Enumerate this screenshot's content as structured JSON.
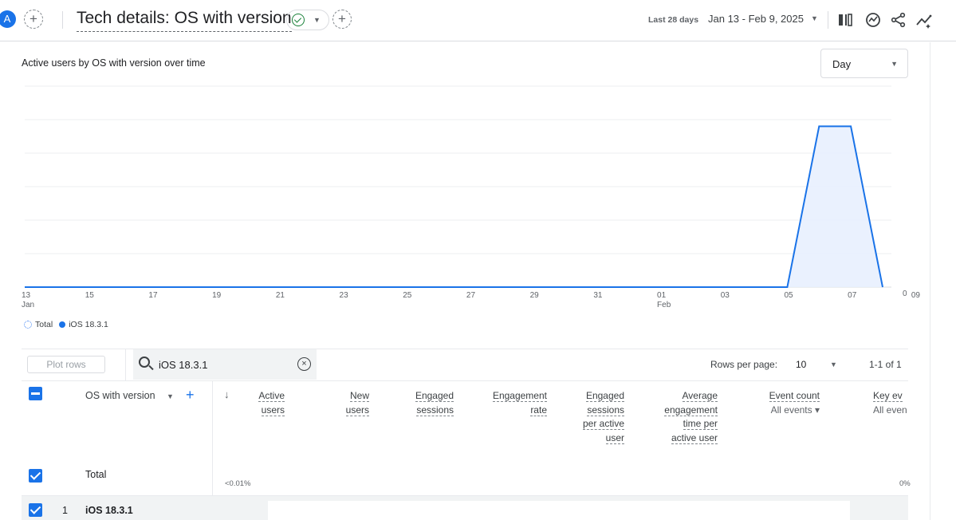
{
  "header": {
    "avatar_letter": "A",
    "report_title": "Tech details: OS with version",
    "date_label": "Last 28 days",
    "date_range": "Jan 13 - Feb 9, 2025",
    "icons": [
      "compare-icon",
      "insights-icon",
      "share-icon",
      "trending-icon"
    ]
  },
  "chart": {
    "title": "Active users by OS with version over time",
    "granularity": "Day",
    "y_tick_zero": "0",
    "legend": {
      "total": "Total",
      "series": "iOS 18.3.1"
    },
    "x_ticks": [
      {
        "day": "13",
        "month": "Jan"
      },
      {
        "day": "15",
        "month": ""
      },
      {
        "day": "17",
        "month": ""
      },
      {
        "day": "19",
        "month": ""
      },
      {
        "day": "21",
        "month": ""
      },
      {
        "day": "23",
        "month": ""
      },
      {
        "day": "25",
        "month": ""
      },
      {
        "day": "27",
        "month": ""
      },
      {
        "day": "29",
        "month": ""
      },
      {
        "day": "31",
        "month": ""
      },
      {
        "day": "01",
        "month": "Feb"
      },
      {
        "day": "03",
        "month": ""
      },
      {
        "day": "05",
        "month": ""
      },
      {
        "day": "07",
        "month": ""
      },
      {
        "day": "09",
        "month": ""
      }
    ]
  },
  "chart_data": {
    "type": "area",
    "title": "Active users by OS with version over time",
    "x": [
      "Jan 13",
      "Jan 14",
      "Jan 15",
      "Jan 16",
      "Jan 17",
      "Jan 18",
      "Jan 19",
      "Jan 20",
      "Jan 21",
      "Jan 22",
      "Jan 23",
      "Jan 24",
      "Jan 25",
      "Jan 26",
      "Jan 27",
      "Jan 28",
      "Jan 29",
      "Jan 30",
      "Jan 31",
      "Feb 01",
      "Feb 02",
      "Feb 03",
      "Feb 04",
      "Feb 05",
      "Feb 06",
      "Feb 07",
      "Feb 08",
      "Feb 09"
    ],
    "series": [
      {
        "name": "iOS 18.3.1",
        "values": [
          0,
          0,
          0,
          0,
          0,
          0,
          0,
          0,
          0,
          0,
          0,
          0,
          0,
          0,
          0,
          0,
          0,
          0,
          0,
          0,
          0,
          0,
          0,
          0,
          0,
          1,
          1,
          0
        ]
      }
    ],
    "ylim": [
      0,
      1.25
    ],
    "y_ticks_labeled": [
      "0"
    ],
    "grid": true,
    "legend_position": "bottom-left",
    "color": "#1a73e8"
  },
  "table": {
    "plot_rows_label": "Plot rows",
    "search_value": "iOS 18.3.1",
    "rows_per_page_label": "Rows per page:",
    "rows_per_page_value": "10",
    "pager": "1-1 of 1",
    "dimension_header": "OS with version",
    "metric_headers": [
      {
        "lines": [
          "Active",
          "users"
        ],
        "sub": ""
      },
      {
        "lines": [
          "New",
          "users"
        ],
        "sub": ""
      },
      {
        "lines": [
          "Engaged",
          "sessions"
        ],
        "sub": ""
      },
      {
        "lines": [
          "Engagement",
          "rate"
        ],
        "sub": ""
      },
      {
        "lines": [
          "Engaged",
          "sessions",
          "per active",
          "user"
        ],
        "sub": ""
      },
      {
        "lines": [
          "Average",
          "engagement",
          "time per",
          "active user"
        ],
        "sub": ""
      },
      {
        "lines": [
          "Event count"
        ],
        "sub": "All events"
      },
      {
        "lines": [
          "Key ev"
        ],
        "sub": "All even"
      }
    ],
    "total_label": "Total",
    "total_active_pct": "<0.01%",
    "total_key_pct": "0%",
    "rows": [
      {
        "index": "1",
        "name": "iOS 18.3.1"
      }
    ]
  }
}
